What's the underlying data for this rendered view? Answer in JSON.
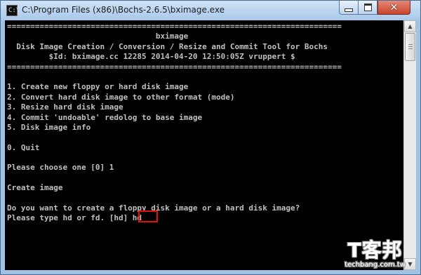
{
  "window": {
    "title": "C:\\Program Files (x86)\\Bochs-2.6.5\\bximage.exe",
    "icon": "console-window-icon",
    "icon_glyph": "C:\\",
    "controls": {
      "minimize": "minimize",
      "maximize": "maximize",
      "close": "✕"
    }
  },
  "console": {
    "lines": [
      "========================================================================",
      "                                bximage",
      "  Disk Image Creation / Conversion / Resize and Commit Tool for Bochs",
      "         $Id: bximage.cc 12285 2014-04-20 12:50:05Z vruppert $",
      "========================================================================",
      "",
      "1. Create new floppy or hard disk image",
      "2. Convert hard disk image to other format (mode)",
      "3. Resize hard disk image",
      "4. Commit 'undoable' redolog to base image",
      "5. Disk image info",
      "",
      "0. Quit",
      "",
      "Please choose one [0] 1",
      "",
      "Create image",
      "",
      "Do you want to create a floppy disk image or a hard disk image?",
      "Please type hd or fd. [hd] hd"
    ]
  },
  "scrollbar": {
    "up_arrow": "▲",
    "down_arrow": "▼",
    "position": 0
  },
  "watermark": {
    "logo": "T客邦",
    "site": "techbang.com.tw"
  },
  "colors": {
    "console_bg": "#000000",
    "console_text": "#c0c0c0",
    "highlight_box": "#e01010",
    "close_button": "#c8432c"
  }
}
